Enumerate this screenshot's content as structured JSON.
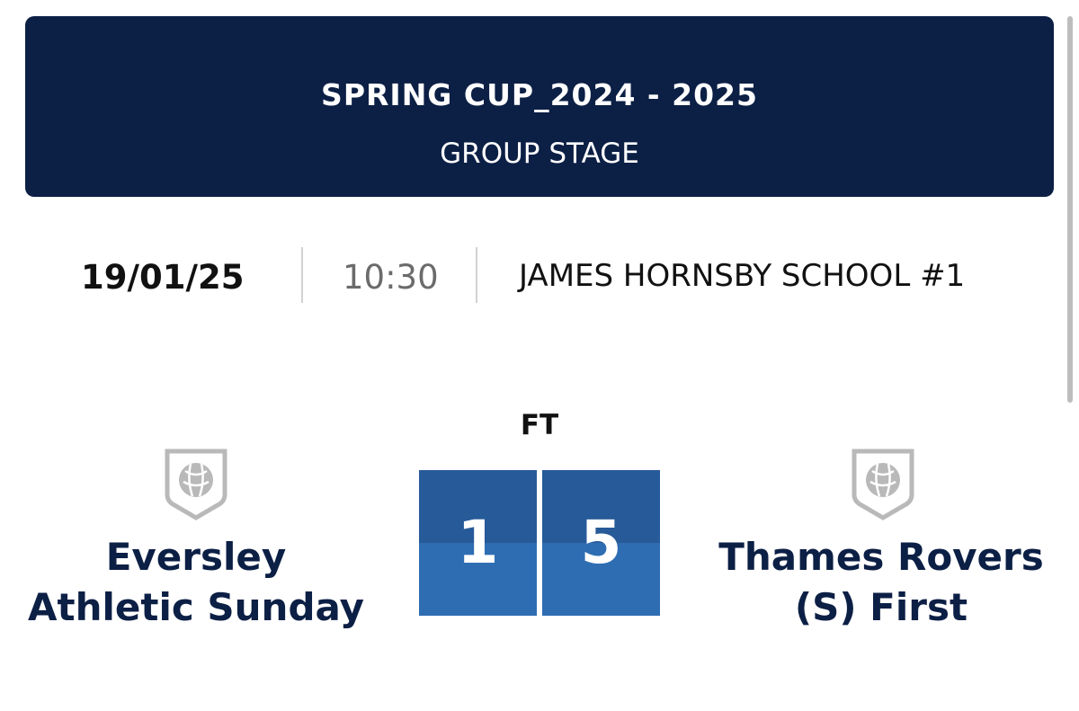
{
  "competition": {
    "title": "SPRING CUP_2024 - 2025",
    "stage": "GROUP STAGE"
  },
  "match_info": {
    "date": "19/01/25",
    "time": "10:30",
    "venue": "JAMES HORNSBY SCHOOL #1"
  },
  "match": {
    "status": "FT",
    "home": {
      "name_line1": "Eversley",
      "name_line2": "Athletic Sunday",
      "score": "1",
      "crest_icon": "shield-football-icon"
    },
    "away": {
      "name_line1": "Thames Rovers",
      "name_line2": "(S) First",
      "score": "5",
      "crest_icon": "shield-football-icon"
    }
  },
  "colors": {
    "banner": "#0c1f45",
    "score_box": "#2f6db2",
    "score_box_top": "#275a98",
    "team_name": "#0c1f45"
  }
}
